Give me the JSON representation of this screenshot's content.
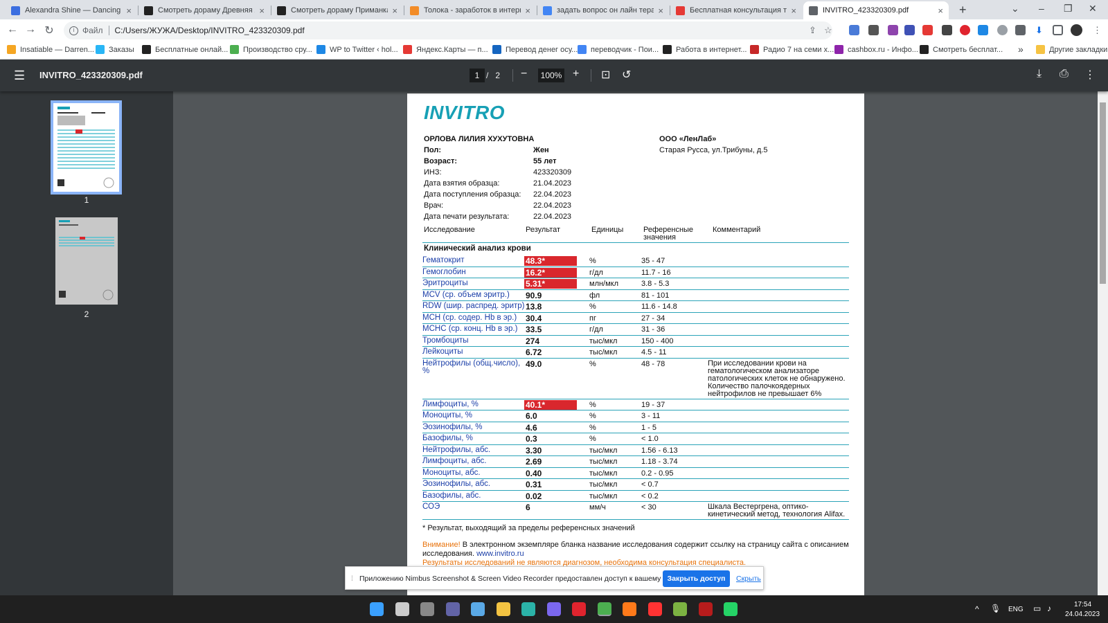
{
  "browser": {
    "tabs": [
      {
        "title": "Alexandra Shine — Dancing Ho",
        "color": "#3b6ee0"
      },
      {
        "title": "Смотреть дораму Древняя лю",
        "color": "#222222"
      },
      {
        "title": "Смотреть дораму Приманка (Е",
        "color": "#222222"
      },
      {
        "title": "Толока - заработок в интерне",
        "color": "#f28c28"
      },
      {
        "title": "задать вопрос он лайн терапе",
        "color": "#4285f4"
      },
      {
        "title": "Бесплатная консультация тера",
        "color": "#e53935"
      },
      {
        "title": "INVITRO_423320309.pdf",
        "color": "#5f6368"
      }
    ],
    "omnibox": {
      "scheme": "Файл",
      "path": "C:/Users/ЖУЖА/Desktop/INVITRO_423320309.pdf"
    },
    "bookmarks": [
      {
        "label": "Insatiable — Darren...",
        "color": "#f5a623"
      },
      {
        "label": "Заказы",
        "color": "#29b6f6"
      },
      {
        "label": "Бесплатные онлай...",
        "color": "#222222"
      },
      {
        "label": "Производство сру...",
        "color": "#4caf50"
      },
      {
        "label": "WP to Twitter ‹ hol...",
        "color": "#1e88e5"
      },
      {
        "label": "Яндекс.Карты — п...",
        "color": "#e53935"
      },
      {
        "label": "Перевод денег осу...",
        "color": "#1565c0"
      },
      {
        "label": "переводчик - Пои...",
        "color": "#4285f4"
      },
      {
        "label": "Работа в интернет...",
        "color": "#222222"
      },
      {
        "label": "Радио 7 на семи х...",
        "color": "#c62828"
      },
      {
        "label": "cashbox.ru - Инфо...",
        "color": "#8e24aa"
      },
      {
        "label": "Смотреть бесплат...",
        "color": "#222222"
      }
    ],
    "bookmarks_more": "»",
    "other_bookmarks": "Другие закладки"
  },
  "pdf": {
    "filename": "INVITRO_423320309.pdf",
    "page_current": "1",
    "page_sep": "/",
    "page_total": "2",
    "zoom": "100%",
    "thumbs": [
      "1",
      "2"
    ],
    "document": {
      "logo": "INVITRO",
      "patient": {
        "name": "ОРЛОВА ЛИЛИЯ ХУХУТОВНА",
        "rows": [
          {
            "label": "Пол:",
            "value": "Жен",
            "bold": true
          },
          {
            "label": "Возраст:",
            "value": "55 лет",
            "bold": true
          },
          {
            "label": "ИНЗ:",
            "value": "423320309",
            "bold": false
          },
          {
            "label": "Дата взятия образца:",
            "value": "21.04.2023",
            "bold": false
          },
          {
            "label": "Дата поступления образца:",
            "value": "22.04.2023",
            "bold": false
          },
          {
            "label": "Врач:",
            "value": "22.04.2023",
            "bold": false
          },
          {
            "label": "Дата печати результата:",
            "value": "22.04.2023",
            "bold": false
          }
        ]
      },
      "lab": {
        "name": "ООО «ЛенЛаб»",
        "address": "Старая Русса, ул.Трибуны, д.5"
      },
      "table_headers": {
        "test": "Исследование",
        "result": "Результат",
        "units": "Единицы",
        "ref1": "Референсные",
        "ref2": "значения",
        "comment": "Комментарий"
      },
      "section": "Клинический анализ крови",
      "rows": [
        {
          "name": "Гематокрит",
          "value": "48.3*",
          "unit": "%",
          "ref": "35 - 47",
          "high": true
        },
        {
          "name": "Гемоглобин",
          "value": "16.2*",
          "unit": "г/дл",
          "ref": "11.7 - 16",
          "high": true
        },
        {
          "name": "Эритроциты",
          "value": "5.31*",
          "unit": "млн/мкл",
          "ref": "3.8 - 5.3",
          "high": true
        },
        {
          "name": "MCV (ср. объем эритр.)",
          "value": "90.9",
          "unit": "фл",
          "ref": "81 - 101",
          "high": false
        },
        {
          "name": "RDW (шир. распред. эритр)",
          "value": "13.8",
          "unit": "%",
          "ref": "11.6 - 14.8",
          "high": false
        },
        {
          "name": "MCH (ср. содер. Hb в эр.)",
          "value": "30.4",
          "unit": "пг",
          "ref": "27 - 34",
          "high": false
        },
        {
          "name": "MCHC (ср. конц. Hb в эр.)",
          "value": "33.5",
          "unit": "г/дл",
          "ref": "31 - 36",
          "high": false
        },
        {
          "name": "Тромбоциты",
          "value": "274",
          "unit": "тыс/мкл",
          "ref": "150 - 400",
          "high": false
        },
        {
          "name": "Лейкоциты",
          "value": "6.72",
          "unit": "тыс/мкл",
          "ref": "4.5 - 11",
          "high": false
        },
        {
          "name": "Нейтрофилы (общ.число),",
          "name2": "%",
          "value": "49.0",
          "unit": "%",
          "ref": "48 - 78",
          "high": false,
          "comment": [
            "При исследовании крови на",
            "гематологическом анализаторе",
            "патологических клеток не обнаружено.",
            "Количество палочкоядерных",
            "нейтрофилов не превышает 6%"
          ]
        },
        {
          "name": "Лимфоциты, %",
          "value": "40.1*",
          "unit": "%",
          "ref": "19 - 37",
          "high": true
        },
        {
          "name": "Моноциты, %",
          "value": "6.0",
          "unit": "%",
          "ref": "3 - 11",
          "high": false
        },
        {
          "name": "Эозинофилы, %",
          "value": "4.6",
          "unit": "%",
          "ref": "1 - 5",
          "high": false
        },
        {
          "name": "Базофилы, %",
          "value": "0.3",
          "unit": "%",
          "ref": "< 1.0",
          "high": false
        },
        {
          "name": "Нейтрофилы, абс.",
          "value": "3.30",
          "unit": "тыс/мкл",
          "ref": "1.56 - 6.13",
          "high": false
        },
        {
          "name": "Лимфоциты, абс.",
          "value": "2.69",
          "unit": "тыс/мкл",
          "ref": "1.18 - 3.74",
          "high": false
        },
        {
          "name": "Моноциты, абс.",
          "value": "0.40",
          "unit": "тыс/мкл",
          "ref": "0.2 - 0.95",
          "high": false
        },
        {
          "name": "Эозинофилы, абс.",
          "value": "0.31",
          "unit": "тыс/мкл",
          "ref": "< 0.7",
          "high": false
        },
        {
          "name": "Базофилы, абс.",
          "value": "0.02",
          "unit": "тыс/мкл",
          "ref": "< 0.2",
          "high": false
        },
        {
          "name": "СОЭ",
          "value": "6",
          "unit": "мм/ч",
          "ref": "< 30",
          "high": false,
          "comment": [
            "Шкала Вестергрена, оптико-",
            "кинетический метод, технология Alifax."
          ]
        }
      ],
      "footnote": "* Результат, выходящий за пределы референсных значений",
      "warning_label": "Внимание!",
      "warning_text": " В электронном экземпляре бланка название исследования содержит ссылку на страницу сайта с описанием",
      "warning_text2": "исследования.",
      "warning_link": "www.invitro.ru",
      "disclaimer": "Результаты исследований не являются диагнозом, необходима консультация специалиста."
    }
  },
  "notice": {
    "message": "Приложению Nimbus Screenshot & Screen Video Recorder предоставлен доступ к вашему экрану.",
    "stop_button": "Закрыть доступ",
    "hide_link": "Скрыть"
  },
  "taskbar": {
    "apps": [
      {
        "name": "start",
        "color": "#3aa0ff"
      },
      {
        "name": "search",
        "color": "#cccccc"
      },
      {
        "name": "task-view",
        "color": "#888888"
      },
      {
        "name": "teams",
        "color": "#6264a7"
      },
      {
        "name": "photos",
        "color": "#5aa9e6"
      },
      {
        "name": "explorer",
        "color": "#f3c342"
      },
      {
        "name": "edge",
        "color": "#2bb3a8"
      },
      {
        "name": "app-c",
        "color": "#7b68ee"
      },
      {
        "name": "opera",
        "color": "#e0242e"
      },
      {
        "name": "chrome",
        "color": "#4caf50"
      },
      {
        "name": "firefox",
        "color": "#ff7a1a"
      },
      {
        "name": "yandex",
        "color": "#ff3333"
      },
      {
        "name": "app-leaf",
        "color": "#7cb342"
      },
      {
        "name": "app-red",
        "color": "#b71c1c"
      },
      {
        "name": "whatsapp",
        "color": "#25d366"
      }
    ],
    "lang": "ENG",
    "time": "17:54",
    "date": "24.04.2023"
  }
}
